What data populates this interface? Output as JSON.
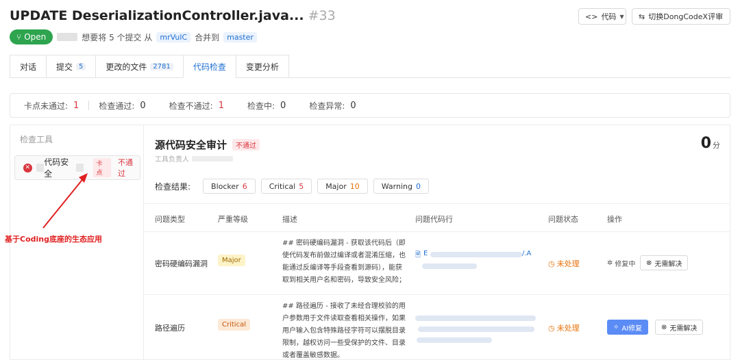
{
  "header": {
    "title": "UPDATE DeserializationController.java...",
    "number": "#33",
    "code_button": "代码",
    "switch_button": "切换DongCodeX评审"
  },
  "meta": {
    "status": "Open",
    "text_before": "想要将 5 个提交 从",
    "source_branch": "mrVulC",
    "text_middle": "合并到",
    "target_branch": "master"
  },
  "tabs": [
    {
      "label": "对话",
      "count": ""
    },
    {
      "label": "提交",
      "count": "5"
    },
    {
      "label": "更改的文件",
      "count": "2781"
    },
    {
      "label": "代码检查",
      "count": ""
    },
    {
      "label": "变更分析",
      "count": ""
    }
  ],
  "stats": [
    {
      "label": "卡点未通过:",
      "value": "1"
    },
    {
      "label": "检查通过:",
      "value": "0"
    },
    {
      "label": "检查不通过:",
      "value": "1"
    },
    {
      "label": "检查中:",
      "value": "0"
    },
    {
      "label": "检查异常:",
      "value": "0"
    }
  ],
  "sidebar": {
    "title": "检查工具",
    "tool_name": "代码安全",
    "tool_tag": "卡点",
    "tool_status": "不通过"
  },
  "annotation": "基于Coding底座的生态应用",
  "audit": {
    "title": "源代码安全审计",
    "status_tag": "不通过",
    "owner_label": "工具负责人",
    "score": "0",
    "score_unit": "分",
    "result_label": "检查结果:",
    "chips": [
      {
        "label": "Blocker",
        "value": "6"
      },
      {
        "label": "Critical",
        "value": "5"
      },
      {
        "label": "Major",
        "value": "10"
      },
      {
        "label": "Warning",
        "value": "0"
      }
    ]
  },
  "table": {
    "headers": [
      "问题类型",
      "严重等级",
      "描述",
      "问题代码行",
      "问题状态",
      "操作"
    ],
    "rows": [
      {
        "type": "密码硬编码漏洞",
        "severity": "Major",
        "desc": "## 密码硬编码漏洞 - 获取该代码后（即使代码发布前做过编译或者混淆压缩，也能通过反编译等手段查看到源码），能获取到相关用户名和密码，导致安全风险；",
        "code_prefix": "E",
        "code_suffix": "/.A",
        "status": "未处理",
        "op1": "修复中",
        "op2": "无需解决"
      },
      {
        "type": "路径遍历",
        "severity": "Critical",
        "desc": "## 路径遍历 - 接收了未经合理校验的用户参数用于文件读取查看相关操作，如果用户输入包含特殊路径字符可以摆脱目录限制，越权访问一些受保护的文件、目录或者覆盖敏感数据。",
        "status": "未处理",
        "op1": "AI修复",
        "op2": "无需解决"
      }
    ]
  }
}
